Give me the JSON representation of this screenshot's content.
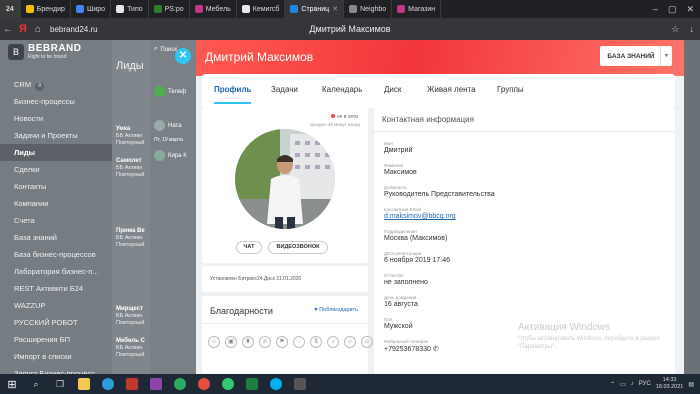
{
  "browser": {
    "tab_counter": "24",
    "tabs": [
      {
        "label": "Брендир",
        "color": "#f4c000"
      },
      {
        "label": "Широ",
        "color": "#4285f4"
      },
      {
        "label": "Типо",
        "color": "#e8e8e8"
      },
      {
        "label": "PS:ро",
        "color": "#2e7d32"
      },
      {
        "label": "Мебель",
        "color": "#c13584"
      },
      {
        "label": "Кемигсб",
        "color": "#e8e8e8"
      },
      {
        "label": "Страниц",
        "color": "#1e88e5"
      },
      {
        "label": "Neighbo",
        "color": "#888888"
      },
      {
        "label": "Магазин",
        "color": "#c13584"
      }
    ],
    "url": "bebrand24.ru",
    "page_title": "Дмитрий Максимов"
  },
  "sidebar": {
    "brand_name": "BEBRAND",
    "brand_tagline": "Right to be brand",
    "items": [
      {
        "label": "CRM",
        "count": "8"
      },
      {
        "label": "Бизнес-процессы"
      },
      {
        "label": "Новости"
      },
      {
        "label": "Задачи и Проекты"
      },
      {
        "label": "Лиды"
      },
      {
        "label": "Сделки"
      },
      {
        "label": "Контакты"
      },
      {
        "label": "Компании"
      },
      {
        "label": "Счета"
      },
      {
        "label": "База знаний"
      },
      {
        "label": "База бизнес-процессов"
      },
      {
        "label": "Лаборатория бизнес-п..."
      },
      {
        "label": "REST Активити Б24"
      },
      {
        "label": "WAZZUP"
      },
      {
        "label": "РУССКИЙ РОБОТ"
      },
      {
        "label": "Расширения БП"
      },
      {
        "label": "Импорт в списки"
      },
      {
        "label": "Запуск Бизнес-процесс..."
      }
    ]
  },
  "leads": {
    "title": "Лиды",
    "cards": [
      {
        "name": "Умка",
        "sub": "ББ Активн",
        "meta": "Повторный"
      },
      {
        "name": "Самолет",
        "sub": "ББ Активн",
        "meta": "Повторный"
      },
      {
        "name": "Прима Ве",
        "sub": "ББ Активн",
        "meta": "Повторный"
      },
      {
        "name": "Мирщест",
        "sub": "ББ Активн",
        "meta": "Повторный"
      },
      {
        "name": "Мебель С",
        "sub": "ББ Активн",
        "meta": "Повторный"
      }
    ]
  },
  "chat": {
    "search": "Поиск",
    "contacts": [
      {
        "name": "Телеф"
      },
      {
        "name": "Ната"
      },
      {
        "name": "Кира К"
      }
    ],
    "date_label": "Пт, 19 марта"
  },
  "profile": {
    "name": "Дмитрий Максимов",
    "knowledge_btn": "БАЗА ЗНАНИЙ",
    "tabs": [
      "Профиль",
      "Задачи",
      "Календарь",
      "Диск",
      "Живая лента",
      "Группы"
    ],
    "status": "не в сети",
    "last_seen": "заходил 40 минут назад",
    "chat_btn": "ЧАТ",
    "video_btn": "ВИДЕОЗВОНОК",
    "installed": "Установлен Битрикс24.Диск 31.01.2020",
    "thanks_title": "Благодарности",
    "thanks_btn": "Поблагодарить",
    "contact_title": "Контактная информация",
    "fields": [
      {
        "label": "Имя",
        "value": "Дмитрий"
      },
      {
        "label": "Фамилия",
        "value": "Максимов"
      },
      {
        "label": "Должность",
        "value": "Руководитель Представительства"
      },
      {
        "label": "Контактный Email",
        "value": "d.maksimov@bbcg.org"
      },
      {
        "label": "Подразделения",
        "value": "Москва (Максимов)"
      },
      {
        "label": "Дата регистрации",
        "value": "6 ноября 2019 17:46"
      },
      {
        "label": "Отчество",
        "value": "не заполнено"
      },
      {
        "label": "День рождения",
        "value": "16 августа"
      },
      {
        "label": "Пол",
        "value": "Мужской"
      },
      {
        "label": "Мобильный телефон",
        "value": "+79253678330 ✆"
      }
    ]
  },
  "watermark": {
    "line1": "Активация Windows",
    "line2": "Чтобы активировать Windows, перейдите в раздел \"Параметры\"."
  },
  "taskbar": {
    "lang": "РУС",
    "time": "14:33",
    "date": "18.03.2021"
  }
}
